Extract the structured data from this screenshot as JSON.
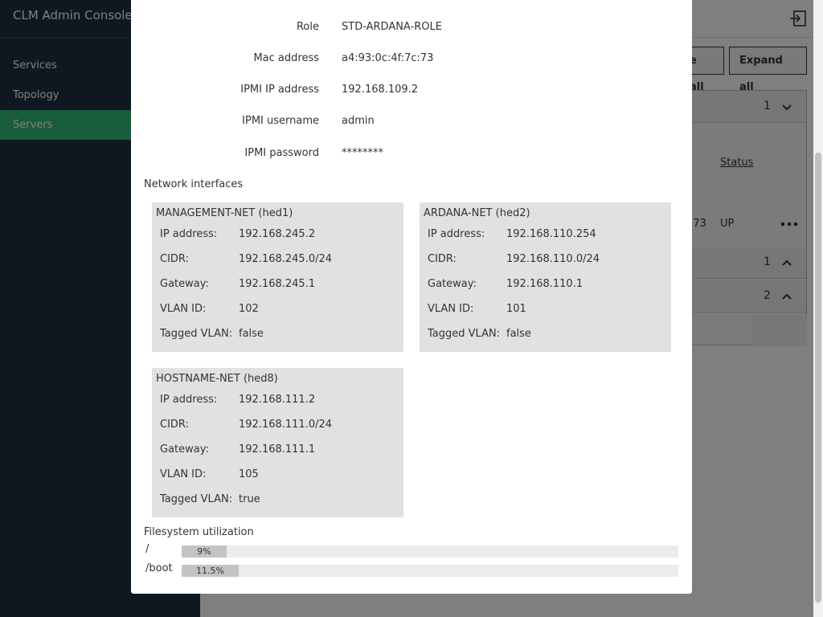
{
  "app": {
    "title": "CLM Admin Console",
    "nav": [
      {
        "label": "Services",
        "active": false
      },
      {
        "label": "Topology",
        "active": false
      },
      {
        "label": "Servers",
        "active": true
      }
    ]
  },
  "background": {
    "collapse_all_label": "e all",
    "expand_all_label": "Expand all",
    "groups": [
      {
        "count": "1",
        "expanded": true
      },
      {
        "count": "1",
        "expanded": false
      },
      {
        "count": "2",
        "expanded": false
      }
    ],
    "status_header": "Status",
    "row_mac_fragment": ":73",
    "row_status": "UP",
    "row_actions_icon": "more-horizontal-icon"
  },
  "modal": {
    "details": [
      {
        "label": "Role",
        "value": "STD-ARDANA-ROLE"
      },
      {
        "label": "Mac address",
        "value": "a4:93:0c:4f:7c:73"
      },
      {
        "label": "IPMI IP address",
        "value": "192.168.109.2"
      },
      {
        "label": "IPMI username",
        "value": "admin"
      },
      {
        "label": "IPMI password",
        "value": "********"
      }
    ],
    "network_title": "Network interfaces",
    "field_labels": {
      "ip": "IP address:",
      "cidr": "CIDR:",
      "gateway": "Gateway:",
      "vlan": "VLAN ID:",
      "tagged": "Tagged VLAN:"
    },
    "networks": [
      {
        "name": "MANAGEMENT-NET (hed1)",
        "ip": "192.168.245.2",
        "cidr": "192.168.245.0/24",
        "gateway": "192.168.245.1",
        "vlan": "102",
        "tagged": "false"
      },
      {
        "name": "ARDANA-NET (hed2)",
        "ip": "192.168.110.254",
        "cidr": "192.168.110.0/24",
        "gateway": "192.168.110.1",
        "vlan": "101",
        "tagged": "false"
      },
      {
        "name": "HOSTNAME-NET (hed8)",
        "ip": "192.168.111.2",
        "cidr": "192.168.111.0/24",
        "gateway": "192.168.111.1",
        "vlan": "105",
        "tagged": "true"
      }
    ],
    "filesystem_title": "Filesystem utilization",
    "filesystems": [
      {
        "mount": "/",
        "percent": 9,
        "label": "9%"
      },
      {
        "mount": "/boot",
        "percent": 11.5,
        "label": "11.5%"
      }
    ]
  },
  "colors": {
    "sidebar": "#1e3040",
    "active_nav": "#30ba78",
    "card": "#e1e1e1",
    "bar_fill": "#c3c3c3",
    "bar_track": "#ececec"
  }
}
